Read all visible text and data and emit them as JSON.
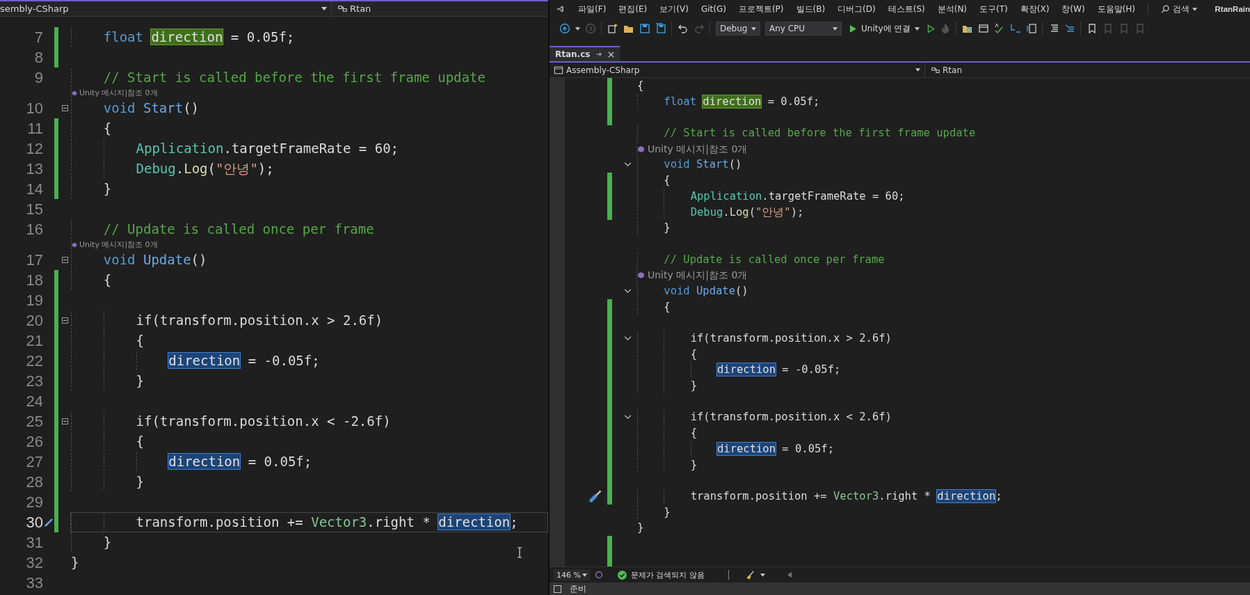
{
  "left_editor": {
    "nav": {
      "project": "sembly-CSharp",
      "member": "Rtan"
    },
    "lines": [
      {
        "kind": "code",
        "number": "7",
        "changed": true,
        "foldable": false,
        "current": false,
        "tokens": [
          {
            "text": "    float ",
            "kind": "keyword"
          },
          {
            "text": "direction",
            "kind": "definition"
          },
          {
            "text": " = 0.05f;",
            "kind": "plain"
          }
        ]
      },
      {
        "kind": "code",
        "number": "8",
        "changed": true,
        "foldable": false,
        "current": false
      },
      {
        "kind": "code",
        "number": "9",
        "changed": false,
        "foldable": false,
        "current": false,
        "tokens": [
          {
            "text": "    // Start is called before the first frame update",
            "kind": "comment"
          }
        ]
      },
      {
        "kind": "codelens",
        "text": "Unity 메시지|참조 0개"
      },
      {
        "kind": "code",
        "number": "10",
        "changed": false,
        "foldable": true,
        "current": false,
        "tokens": [
          {
            "text": "    void ",
            "kind": "keyword"
          },
          {
            "text": "Start",
            "kind": "method"
          },
          {
            "text": "()",
            "kind": "plain"
          }
        ]
      },
      {
        "kind": "code",
        "number": "11",
        "changed": true,
        "foldable": false,
        "current": false,
        "tokens": [
          {
            "text": "    {",
            "kind": "plain"
          }
        ]
      },
      {
        "kind": "code",
        "number": "12",
        "changed": true,
        "foldable": false,
        "current": false,
        "tokens": [
          {
            "text": "        Application",
            "kind": "class"
          },
          {
            "text": ".targetFrameRate = 60;",
            "kind": "plain"
          }
        ]
      },
      {
        "kind": "code",
        "number": "13",
        "changed": true,
        "foldable": false,
        "current": false,
        "tokens": [
          {
            "text": "        Debug",
            "kind": "class"
          },
          {
            "text": ".",
            "kind": "plain"
          },
          {
            "text": "Log",
            "kind": "call"
          },
          {
            "text": "(",
            "kind": "plain"
          },
          {
            "text": "\"안녕\"",
            "kind": "string"
          },
          {
            "text": ");",
            "kind": "plain"
          }
        ]
      },
      {
        "kind": "code",
        "number": "14",
        "changed": true,
        "foldable": false,
        "current": false,
        "tokens": [
          {
            "text": "    }",
            "kind": "plain"
          }
        ]
      },
      {
        "kind": "code",
        "number": "15",
        "changed": false,
        "foldable": false,
        "current": false
      },
      {
        "kind": "code",
        "number": "16",
        "changed": false,
        "foldable": false,
        "current": false,
        "tokens": [
          {
            "text": "    // Update is called once per frame",
            "kind": "comment"
          }
        ]
      },
      {
        "kind": "codelens",
        "text": "Unity 메시지|참조 0개"
      },
      {
        "kind": "code",
        "number": "17",
        "changed": false,
        "foldable": true,
        "current": false,
        "tokens": [
          {
            "text": "    void ",
            "kind": "keyword"
          },
          {
            "text": "Update",
            "kind": "method"
          },
          {
            "text": "()",
            "kind": "plain"
          }
        ]
      },
      {
        "kind": "code",
        "number": "18",
        "changed": true,
        "foldable": false,
        "current": false,
        "tokens": [
          {
            "text": "    {",
            "kind": "plain"
          }
        ]
      },
      {
        "kind": "code",
        "number": "19",
        "changed": true,
        "foldable": false,
        "current": false
      },
      {
        "kind": "code",
        "number": "20",
        "changed": true,
        "foldable": true,
        "current": false,
        "tokens": [
          {
            "text": "        if(transform.position.x > 2.6f)",
            "kind": "plain"
          }
        ]
      },
      {
        "kind": "code",
        "number": "21",
        "changed": true,
        "foldable": false,
        "current": false,
        "tokens": [
          {
            "text": "        {",
            "kind": "plain"
          }
        ]
      },
      {
        "kind": "code",
        "number": "22",
        "changed": true,
        "foldable": false,
        "current": false,
        "tokens": [
          {
            "text": "            direction",
            "kind": "reference"
          },
          {
            "text": " = -0.05f;",
            "kind": "plain"
          }
        ]
      },
      {
        "kind": "code",
        "number": "23",
        "changed": true,
        "foldable": false,
        "current": false,
        "tokens": [
          {
            "text": "        }",
            "kind": "plain"
          }
        ]
      },
      {
        "kind": "code",
        "number": "24",
        "changed": true,
        "foldable": false,
        "current": false
      },
      {
        "kind": "code",
        "number": "25",
        "changed": true,
        "foldable": true,
        "current": false,
        "tokens": [
          {
            "text": "        if(transform.position.x < -2.6f)",
            "kind": "plain"
          }
        ]
      },
      {
        "kind": "code",
        "number": "26",
        "changed": true,
        "foldable": false,
        "current": false,
        "tokens": [
          {
            "text": "        {",
            "kind": "plain"
          }
        ]
      },
      {
        "kind": "code",
        "number": "27",
        "changed": true,
        "foldable": false,
        "current": false,
        "tokens": [
          {
            "text": "            direction",
            "kind": "reference"
          },
          {
            "text": " = 0.05f;",
            "kind": "plain"
          }
        ]
      },
      {
        "kind": "code",
        "number": "28",
        "changed": true,
        "foldable": false,
        "current": false,
        "tokens": [
          {
            "text": "        }",
            "kind": "plain"
          }
        ]
      },
      {
        "kind": "code",
        "number": "29",
        "changed": true,
        "foldable": false,
        "current": false
      },
      {
        "kind": "code",
        "number": "30",
        "changed": true,
        "foldable": false,
        "current": true,
        "tokens": [
          {
            "text": "        transform.position += ",
            "kind": "plain"
          },
          {
            "text": "Vector3",
            "kind": "struct"
          },
          {
            "text": ".right * ",
            "kind": "plain"
          },
          {
            "text": "direction",
            "kind": "reference"
          },
          {
            "text": ";",
            "kind": "plain"
          }
        ]
      },
      {
        "kind": "code",
        "number": "31",
        "changed": false,
        "foldable": false,
        "current": false,
        "tokens": [
          {
            "text": "    }",
            "kind": "plain"
          }
        ]
      },
      {
        "kind": "code",
        "number": "32",
        "changed": false,
        "foldable": false,
        "current": false,
        "tokens": [
          {
            "text": "}",
            "kind": "plain"
          }
        ]
      },
      {
        "kind": "code",
        "number": "33",
        "changed": false,
        "foldable": false,
        "current": false
      }
    ]
  },
  "right_window": {
    "menu": [
      "파일(F)",
      "편집(E)",
      "보기(V)",
      "Git(G)",
      "프로젝트(P)",
      "빌드(B)",
      "디버그(D)",
      "테스트(S)",
      "분석(N)",
      "도구(T)",
      "확장(X)",
      "창(W)",
      "도움말(H)"
    ],
    "search": "검색",
    "user": "RtanRain",
    "toolbar": {
      "configuration": "Debug",
      "platform": "Any CPU",
      "run": "Unity에 연결"
    },
    "tab": {
      "title": "Rtan.cs",
      "selected": true
    },
    "nav": {
      "project": "Assembly-CSharp",
      "member": "Rtan"
    },
    "lines": [
      {
        "kind": "code",
        "changed": true,
        "foldable": false,
        "current": false,
        "tokens": [
          {
            "text": "{",
            "kind": "plain"
          }
        ]
      },
      {
        "kind": "code",
        "changed": true,
        "foldable": false,
        "current": false,
        "tokens": [
          {
            "text": "    float ",
            "kind": "keyword"
          },
          {
            "text": "direction",
            "kind": "definition"
          },
          {
            "text": " = 0.05f;",
            "kind": "plain"
          }
        ]
      },
      {
        "kind": "code",
        "changed": true,
        "foldable": false,
        "current": false
      },
      {
        "kind": "code",
        "changed": false,
        "foldable": false,
        "current": false,
        "tokens": [
          {
            "text": "    // Start is called before the first frame update",
            "kind": "comment"
          }
        ]
      },
      {
        "kind": "codelens",
        "text": "Unity 메시지|참조 0개"
      },
      {
        "kind": "code",
        "changed": false,
        "foldable": true,
        "current": false,
        "tokens": [
          {
            "text": "    void ",
            "kind": "keyword"
          },
          {
            "text": "Start",
            "kind": "method"
          },
          {
            "text": "()",
            "kind": "plain"
          }
        ]
      },
      {
        "kind": "code",
        "changed": true,
        "foldable": false,
        "current": false,
        "tokens": [
          {
            "text": "    {",
            "kind": "plain"
          }
        ]
      },
      {
        "kind": "code",
        "changed": true,
        "foldable": false,
        "current": false,
        "tokens": [
          {
            "text": "        Application",
            "kind": "class"
          },
          {
            "text": ".targetFrameRate = 60;",
            "kind": "plain"
          }
        ]
      },
      {
        "kind": "code",
        "changed": true,
        "foldable": false,
        "current": false,
        "tokens": [
          {
            "text": "        Debug",
            "kind": "class"
          },
          {
            "text": ".",
            "kind": "plain"
          },
          {
            "text": "Log",
            "kind": "call"
          },
          {
            "text": "(",
            "kind": "plain"
          },
          {
            "text": "\"안녕\"",
            "kind": "string"
          },
          {
            "text": ");",
            "kind": "plain"
          }
        ]
      },
      {
        "kind": "code",
        "changed": false,
        "foldable": false,
        "current": false,
        "tokens": [
          {
            "text": "    }",
            "kind": "plain"
          }
        ]
      },
      {
        "kind": "code",
        "changed": false,
        "foldable": false,
        "current": false
      },
      {
        "kind": "code",
        "changed": false,
        "foldable": false,
        "current": false,
        "tokens": [
          {
            "text": "    // Update is called once per frame",
            "kind": "comment"
          }
        ]
      },
      {
        "kind": "codelens",
        "text": "Unity 메시지|참조 0개"
      },
      {
        "kind": "code",
        "changed": false,
        "foldable": true,
        "current": false,
        "tokens": [
          {
            "text": "    void ",
            "kind": "keyword"
          },
          {
            "text": "Update",
            "kind": "method"
          },
          {
            "text": "()",
            "kind": "plain"
          }
        ]
      },
      {
        "kind": "code",
        "changed": true,
        "foldable": false,
        "current": false,
        "tokens": [
          {
            "text": "    {",
            "kind": "plain"
          }
        ]
      },
      {
        "kind": "code",
        "changed": true,
        "foldable": false,
        "current": false
      },
      {
        "kind": "code",
        "changed": true,
        "foldable": true,
        "current": false,
        "tokens": [
          {
            "text": "        if(transform.position.x > 2.6f)",
            "kind": "plain"
          }
        ]
      },
      {
        "kind": "code",
        "changed": true,
        "foldable": false,
        "current": false,
        "tokens": [
          {
            "text": "        {",
            "kind": "plain"
          }
        ]
      },
      {
        "kind": "code",
        "changed": true,
        "foldable": false,
        "current": false,
        "tokens": [
          {
            "text": "            direction",
            "kind": "reference"
          },
          {
            "text": " = -0.05f;",
            "kind": "plain"
          }
        ]
      },
      {
        "kind": "code",
        "changed": true,
        "foldable": false,
        "current": false,
        "tokens": [
          {
            "text": "        }",
            "kind": "plain"
          }
        ]
      },
      {
        "kind": "code",
        "changed": true,
        "foldable": false,
        "current": false
      },
      {
        "kind": "code",
        "changed": true,
        "foldable": true,
        "current": false,
        "tokens": [
          {
            "text": "        if(transform.position.x < 2.6f)",
            "kind": "plain"
          }
        ]
      },
      {
        "kind": "code",
        "changed": true,
        "foldable": false,
        "current": false,
        "tokens": [
          {
            "text": "        {",
            "kind": "plain"
          }
        ]
      },
      {
        "kind": "code",
        "changed": true,
        "foldable": false,
        "current": false,
        "tokens": [
          {
            "text": "            direction",
            "kind": "reference"
          },
          {
            "text": " = 0.05f;",
            "kind": "plain"
          }
        ]
      },
      {
        "kind": "code",
        "changed": true,
        "foldable": false,
        "current": false,
        "tokens": [
          {
            "text": "        }",
            "kind": "plain"
          }
        ]
      },
      {
        "kind": "code",
        "changed": true,
        "foldable": false,
        "current": false
      },
      {
        "kind": "code",
        "changed": true,
        "foldable": false,
        "current": true,
        "tokens": [
          {
            "text": "        transform.position += ",
            "kind": "plain"
          },
          {
            "text": "Vector3",
            "kind": "struct"
          },
          {
            "text": ".right * ",
            "kind": "plain"
          },
          {
            "text": "direction",
            "kind": "reference"
          },
          {
            "text": ";",
            "kind": "plain"
          }
        ]
      },
      {
        "kind": "code",
        "changed": false,
        "foldable": false,
        "current": false,
        "tokens": [
          {
            "text": "    }",
            "kind": "plain"
          }
        ]
      },
      {
        "kind": "code",
        "changed": false,
        "foldable": false,
        "current": false,
        "tokens": [
          {
            "text": "}",
            "kind": "plain"
          }
        ]
      },
      {
        "kind": "code",
        "changed": true,
        "foldable": false,
        "current": false
      },
      {
        "kind": "code",
        "changed": true,
        "foldable": false,
        "current": false
      }
    ],
    "status": {
      "zoom": "146 %",
      "issues": "문제가 검색되지 않음"
    },
    "status_bar": "준비"
  }
}
